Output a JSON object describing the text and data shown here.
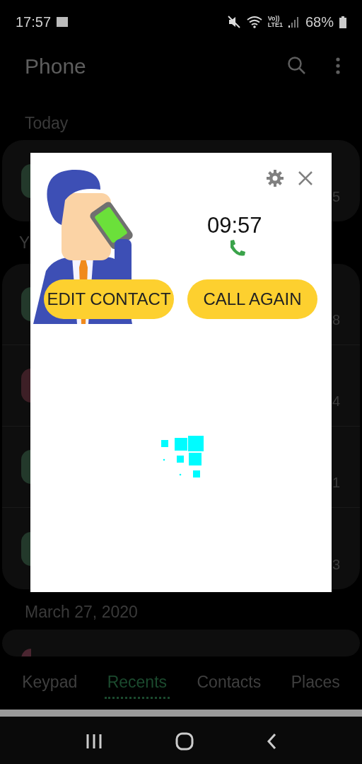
{
  "status_bar": {
    "time": "17:57",
    "network": "Vo))\nLTE1",
    "battery": "68%"
  },
  "app_bar": {
    "title": "Phone"
  },
  "sections": [
    {
      "header": "Today",
      "rows": [
        {
          "color": "#23392b",
          "time": "5"
        }
      ]
    },
    {
      "header": "Y",
      "rows": [
        {
          "color": "#23392b",
          "time": "8"
        },
        {
          "color": "#3d1f26",
          "time": "4"
        },
        {
          "color": "#23392b",
          "time": "1"
        },
        {
          "color": "#23392b",
          "time": "3"
        }
      ]
    },
    {
      "header": "March 27, 2020",
      "rows": [
        {
          "color": "#4a2530"
        }
      ]
    }
  ],
  "dialog": {
    "time": "09:57",
    "buttons": [
      "EDIT CONTACT",
      "CALL AGAIN"
    ]
  },
  "tabs": [
    {
      "label": "Keypad",
      "selected": false
    },
    {
      "label": "Recents",
      "selected": true
    },
    {
      "label": "Contacts",
      "selected": false
    },
    {
      "label": "Places",
      "selected": false
    }
  ]
}
